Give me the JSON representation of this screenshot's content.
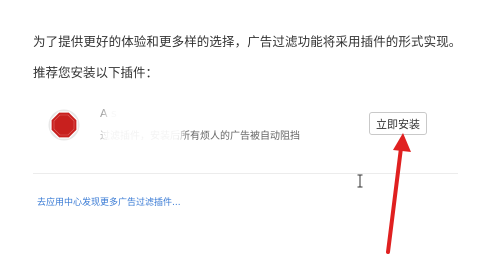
{
  "intro_text": "为了提供更好的体验和更多样的选择，广告过滤功能将采用插件的形式实现。",
  "recommend_label": "推荐您安装以下插件：",
  "plugin": {
    "name": "A          s",
    "description": "              过滤插件，安装后所有烦人的广告被自动阻挡",
    "install_label": "立即安装",
    "icon": "stop-sign-icon",
    "icon_color": "#c8201e"
  },
  "more_link": "去应用中心发现更多广告过滤插件...",
  "colors": {
    "link": "#3a7bd5",
    "arrow": "#e02020"
  }
}
